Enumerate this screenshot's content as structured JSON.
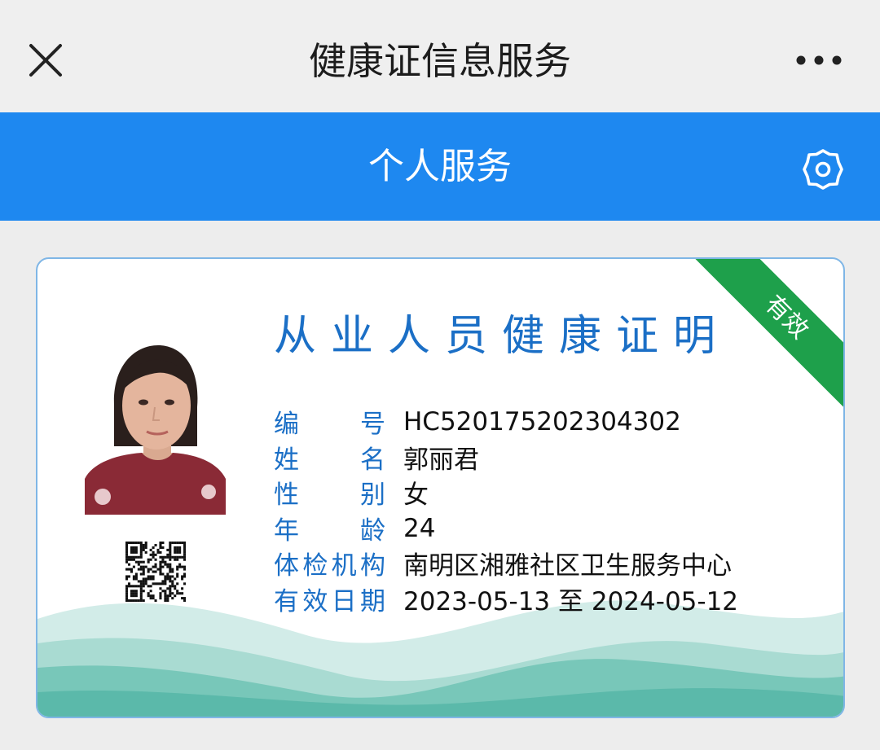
{
  "topbar": {
    "title": "健康证信息服务",
    "close_icon": "close-icon",
    "more_icon": "more-dots-icon"
  },
  "header": {
    "title": "个人服务",
    "settings_icon": "gear-icon",
    "color": "#1e88f0"
  },
  "card": {
    "title": "从业人员健康证明",
    "status": "有效",
    "status_color": "#1ea04b",
    "title_color": "#1b6fc6",
    "fields": [
      {
        "label": "编号",
        "value": "HC520175202304302"
      },
      {
        "label": "姓名",
        "value": "郭丽君"
      },
      {
        "label": "性别",
        "value": "女"
      },
      {
        "label": "年龄",
        "value": "24"
      },
      {
        "label": "体检机构",
        "value": "南明区湘雅社区卫生服务中心"
      },
      {
        "label": "有效日期",
        "value": "2023-05-13 至 2024-05-12"
      }
    ]
  }
}
